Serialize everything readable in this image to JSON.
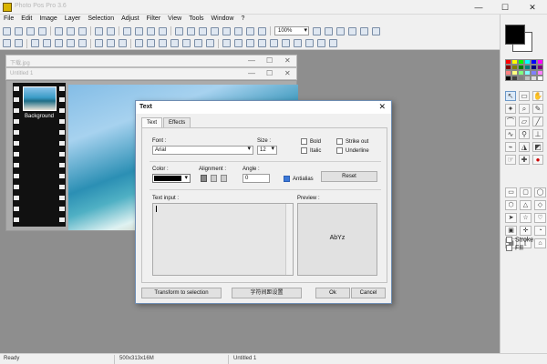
{
  "window": {
    "title": "Photo Pos Pro 3.6",
    "minimize": "—",
    "maximize": "☐",
    "close": "✕"
  },
  "menu": [
    "File",
    "Edit",
    "Image",
    "Layer",
    "Selection",
    "Adjust",
    "Filter",
    "View",
    "Tools",
    "Window",
    "?"
  ],
  "toolbar": {
    "zoom_value": "100%"
  },
  "doc_windows": {
    "back_title": "下载.jpg",
    "front_title": "Untitled 1",
    "layer_label": "Background"
  },
  "dialog": {
    "title": "Text",
    "close": "✕",
    "tabs": [
      "Text",
      "Effects"
    ],
    "font_label": "Font :",
    "font_value": "Arial",
    "size_label": "Size :",
    "size_value": "12",
    "bold": "Bold",
    "italic": "Italic",
    "strikeout": "Strike out",
    "underline": "Underline",
    "color_label": "Color :",
    "color_value": "#000000",
    "alignment_label": "Alignment :",
    "angle_label": "Angle :",
    "angle_value": "0",
    "antialias": "Antialias",
    "reset": "Reset",
    "text_input_label": "Text input :",
    "preview_label": "Preview :",
    "preview_text": "AbYz",
    "transform": "Transform to selection",
    "chinese_button": "字符间距设置",
    "ok": "Ok",
    "cancel": "Cancel"
  },
  "right_panel": {
    "stroke": "Stroke",
    "fill": "Fill",
    "palette": [
      "#ff0000",
      "#ffff00",
      "#00ff00",
      "#00ffff",
      "#0000ff",
      "#ff00ff",
      "#800000",
      "#808000",
      "#008000",
      "#008080",
      "#000080",
      "#800080",
      "#ff8080",
      "#ffff80",
      "#80ff80",
      "#80ffff",
      "#8080ff",
      "#ff80ff",
      "#000000",
      "#404040",
      "#808080",
      "#c0c0c0",
      "#e0e0e0",
      "#ffffff"
    ]
  },
  "status": {
    "ready": "Ready",
    "dims": "500x313x16M",
    "doc": "Untitled 1"
  }
}
